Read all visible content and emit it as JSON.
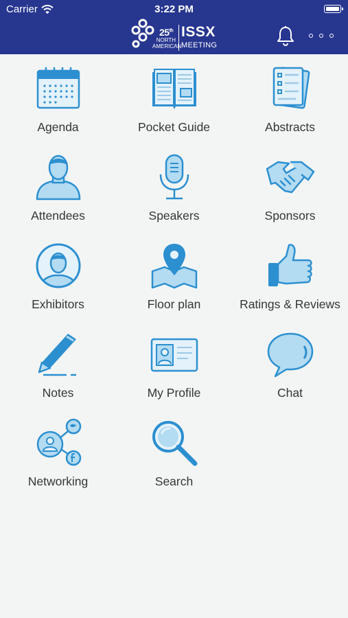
{
  "status_bar": {
    "carrier": "Carrier",
    "time": "3:22 PM"
  },
  "header": {
    "logo": {
      "number": "25",
      "number_suffix": "th",
      "line1": "NORTH",
      "line2": "AMERICAN",
      "title": "ISSX",
      "subtitle": "MEETING"
    },
    "bell_icon": "bell-icon",
    "more_icon": "more-icon"
  },
  "colors": {
    "header": "#27368f",
    "icon_stroke": "#2c8fd0",
    "icon_fill": "#b3dbf2",
    "background": "#f3f5f5",
    "label": "#353535"
  },
  "menu": [
    {
      "label": "Agenda",
      "icon": "calendar-icon"
    },
    {
      "label": "Pocket Guide",
      "icon": "book-icon"
    },
    {
      "label": "Abstracts",
      "icon": "documents-icon"
    },
    {
      "label": "Attendees",
      "icon": "person-icon"
    },
    {
      "label": "Speakers",
      "icon": "microphone-icon"
    },
    {
      "label": "Sponsors",
      "icon": "handshake-icon"
    },
    {
      "label": "Exhibitors",
      "icon": "person-circle-icon"
    },
    {
      "label": "Floor plan",
      "icon": "map-pin-icon"
    },
    {
      "label": "Ratings & Reviews",
      "icon": "thumbs-up-icon"
    },
    {
      "label": "Notes",
      "icon": "pen-icon"
    },
    {
      "label": "My Profile",
      "icon": "id-card-icon"
    },
    {
      "label": "Chat",
      "icon": "chat-bubble-icon"
    },
    {
      "label": "Networking",
      "icon": "network-icon"
    },
    {
      "label": "Search",
      "icon": "magnifier-icon"
    }
  ]
}
